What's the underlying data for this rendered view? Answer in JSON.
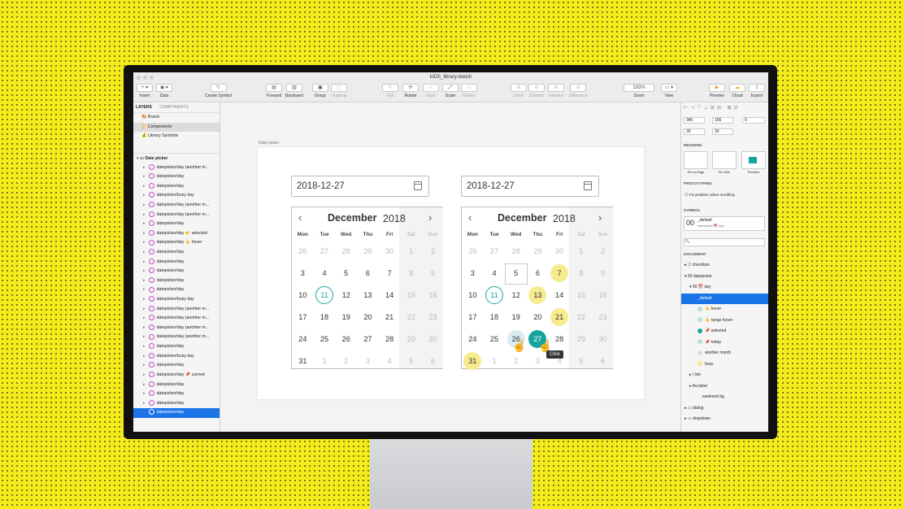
{
  "window": {
    "title": "triDS_library.sketch"
  },
  "toolbar": {
    "insert": "Insert",
    "data": "Data",
    "create_symbol": "Create Symbol",
    "forward": "Forward",
    "backward": "Backward",
    "group": "Group",
    "ungroup": "Ungroup",
    "edit": "Edit",
    "rotate": "Rotate",
    "mask": "Mask",
    "scale": "Scale",
    "flatten": "Flatten",
    "union": "Union",
    "subtract": "Subtract",
    "intersect": "Intersect",
    "difference": "Difference",
    "zoom": "Zoom",
    "zoom_value": "193%",
    "view": "View",
    "preview": "Preview",
    "cloud": "Cloud",
    "export": "Export"
  },
  "left_panel": {
    "tab_layers": "LAYERS",
    "tab_components": "COMPONENTS",
    "pages": [
      "Brand",
      "Components",
      "Library Symbols"
    ],
    "artboard": "Date picker",
    "layers": [
      "datepicker/day (another m...",
      "datepicker/day",
      "datepicker/day",
      "datepicker/busy day",
      "datepicker/day (another m...",
      "datepicker/day (another m...",
      "datepicker/day",
      "datepicker/day 👉 selected",
      "datepicker/day 👆 hover",
      "datepicker/day",
      "datepicker/day",
      "datepicker/day",
      "datepicker/day",
      "datepicker/day",
      "datepicker/busy day",
      "datepicker/day (another m...",
      "datepicker/day (another m...",
      "datepicker/day (another m...",
      "datepicker/day (another m...",
      "datepicker/day",
      "datepicker/busy day",
      "datepicker/day",
      "datepicker/day 📌 current",
      "datepicker/day",
      "datepicker/day",
      "datepicker/day",
      "datepicker/day"
    ]
  },
  "canvas": {
    "artboard_label": "Date picker",
    "left_picker": {
      "input_value": "2018-12-27",
      "month": "December",
      "year": "2018",
      "weekdays": [
        "Mon",
        "Tue",
        "Wed",
        "Thu",
        "Fri",
        "Sat",
        "Sun"
      ],
      "weeks": [
        [
          "26",
          "27",
          "28",
          "29",
          "30",
          "1",
          "2"
        ],
        [
          "3",
          "4",
          "5",
          "6",
          "7",
          "8",
          "9"
        ],
        [
          "10",
          "11",
          "12",
          "13",
          "14",
          "15",
          "16"
        ],
        [
          "17",
          "18",
          "19",
          "20",
          "21",
          "22",
          "23"
        ],
        [
          "24",
          "25",
          "26",
          "27",
          "28",
          "29",
          "30"
        ],
        [
          "31",
          "1",
          "2",
          "3",
          "4",
          "5",
          "6"
        ]
      ]
    },
    "right_picker": {
      "input_value": "2018-12-27",
      "month": "December",
      "year": "2018",
      "weekdays": [
        "Mon",
        "Tue",
        "Wed",
        "Thu",
        "Fri",
        "Sat",
        "Sun"
      ],
      "weeks": [
        [
          "26",
          "27",
          "28",
          "29",
          "30",
          "1",
          "2"
        ],
        [
          "3",
          "4",
          "5",
          "6",
          "7",
          "8",
          "9"
        ],
        [
          "10",
          "11",
          "12",
          "13",
          "14",
          "15",
          "16"
        ],
        [
          "17",
          "18",
          "19",
          "20",
          "21",
          "22",
          "23"
        ],
        [
          "24",
          "25",
          "26",
          "27",
          "28",
          "29",
          "30"
        ],
        [
          "31",
          "1",
          "2",
          "3",
          "4",
          "5",
          "6"
        ]
      ],
      "tooltip": "Click"
    }
  },
  "inspector": {
    "x": "340",
    "y": "156",
    "rotation": "0",
    "width": "30",
    "height": "30",
    "resizing": "RESIZING",
    "pin_to_edge": "Pin to Edge",
    "fix_size": "Fix Size",
    "preview": "Preview",
    "prototyping": "PROTOTYPING",
    "fix_scroll": "Fix position when scrolling",
    "symbol": "SYMBOL",
    "symbol_name": "_default",
    "symbol_path": "datepicker/📆 day/",
    "document": "DOCUMENT",
    "tree": {
      "checkbox": "checkbox",
      "datepicker": "datepicker",
      "day": "📆 day",
      "default": "_default",
      "hover": "👆 hover",
      "range_hover": "👆 range hover",
      "selected": "📌 selected",
      "today": "📌 today",
      "another_month": "another month",
      "busy": "busy",
      "btn": "btn",
      "label": "label",
      "weekend_bg": "weekend bg",
      "dialog": "dialog",
      "dropdown": "dropdown"
    }
  },
  "colors": {
    "accent": "#17a49e",
    "busy": "#f7eb8f",
    "selection": "#1a74e8",
    "background": "#f4ec1a"
  }
}
